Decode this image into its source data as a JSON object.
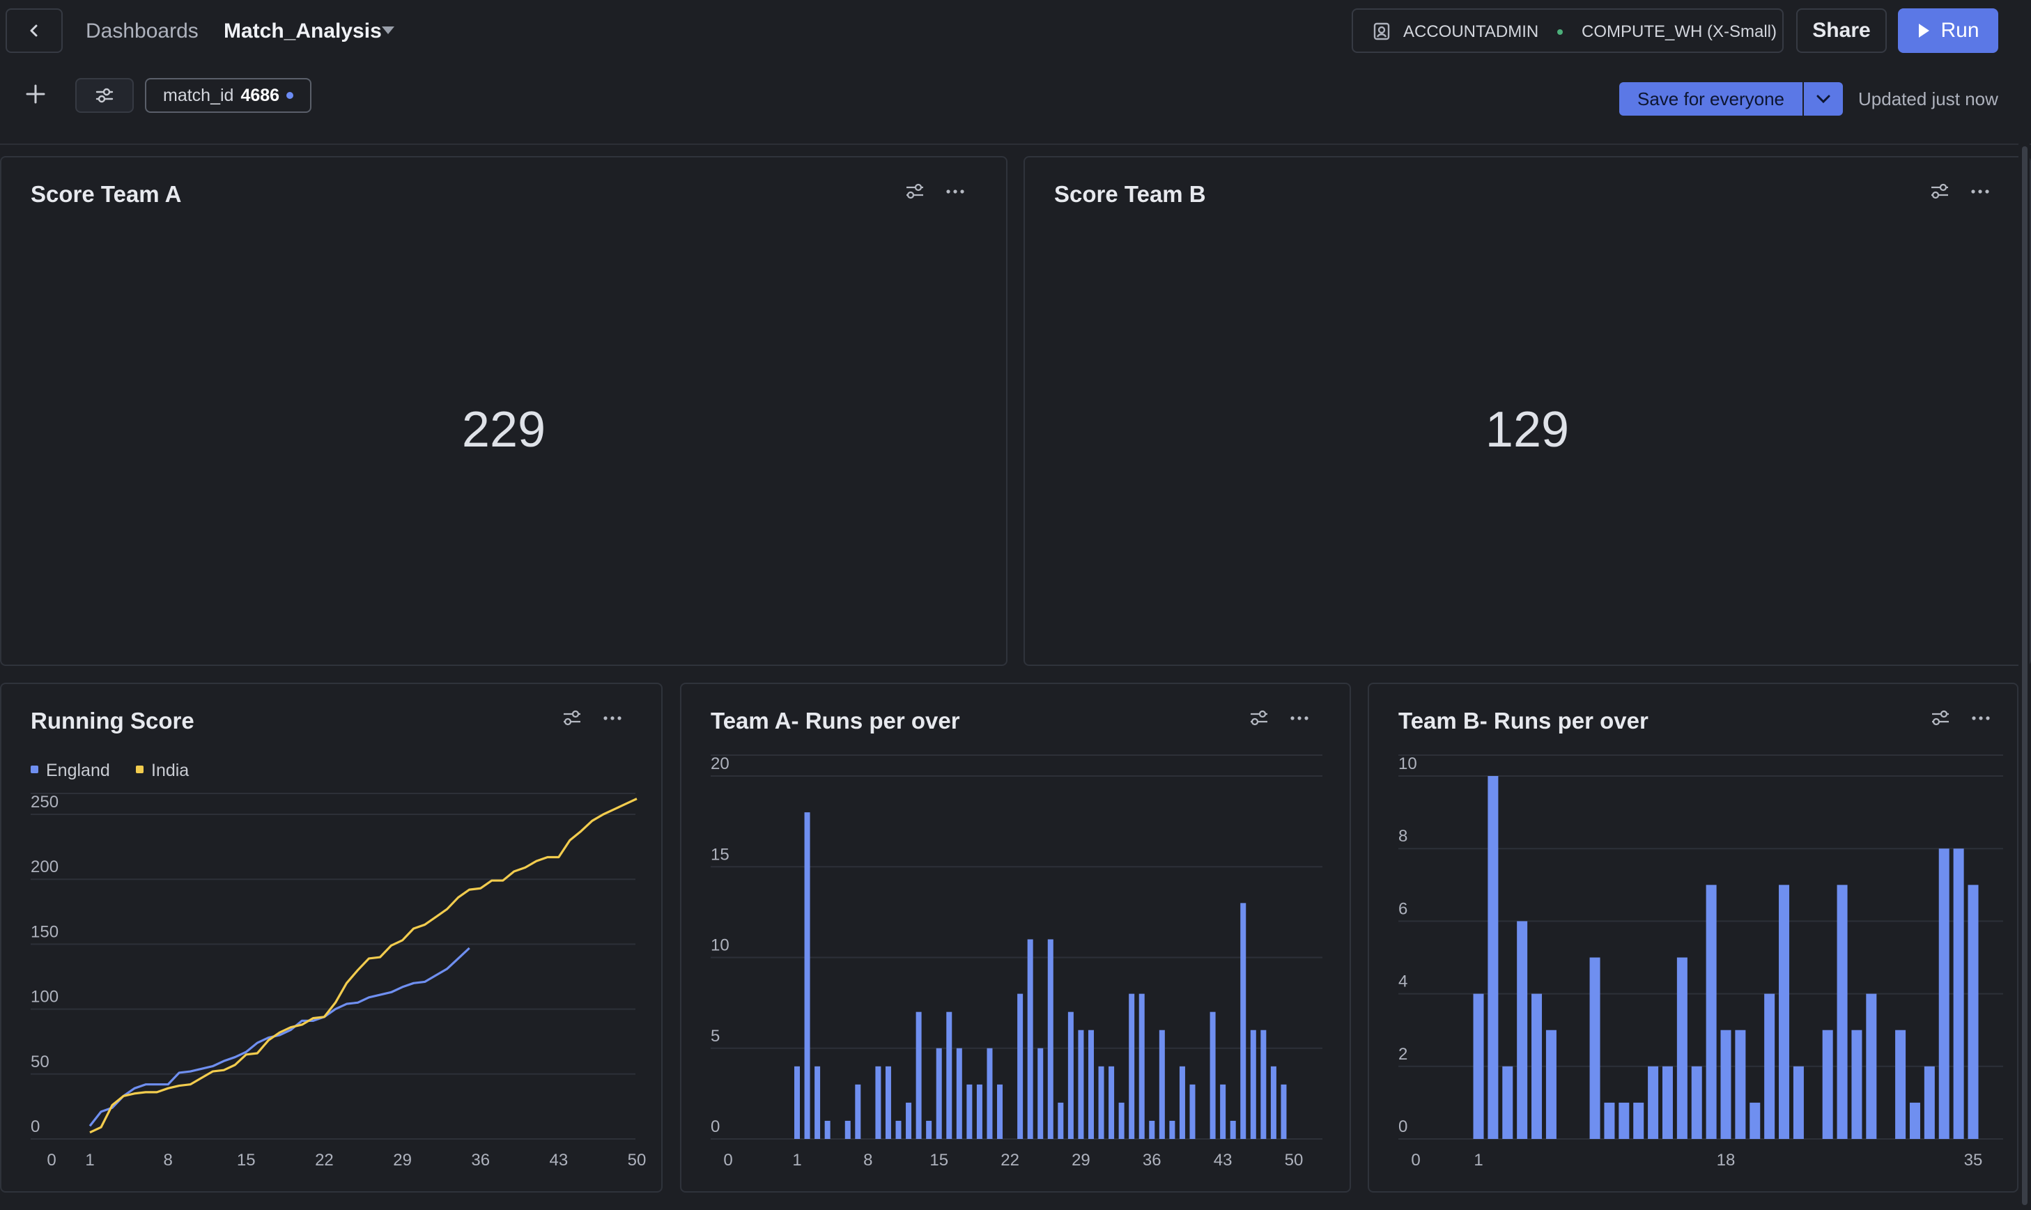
{
  "header": {
    "breadcrumb": "Dashboards",
    "dashboard_title": "Match_Analysis",
    "role": "ACCOUNTADMIN",
    "warehouse": "COMPUTE_WH (X-Small)",
    "share_label": "Share",
    "run_label": "Run"
  },
  "filters": {
    "chip_key": "match_id",
    "chip_value": "4686"
  },
  "actions": {
    "save_label": "Save for everyone",
    "updated_text": "Updated just now"
  },
  "colors": {
    "accent": "#5b78e6",
    "england": "#6f8ff0",
    "india": "#f2cc4e",
    "bar": "#6f8ff0"
  },
  "panels": {
    "score_a": {
      "title": "Score Team A",
      "value": "229"
    },
    "score_b": {
      "title": "Score Team B",
      "value": "129"
    },
    "running": {
      "title": "Running Score"
    },
    "team_a_runs": {
      "title": "Team A- Runs per over"
    },
    "team_b_runs": {
      "title": "Team B- Runs per over"
    }
  },
  "chart_data": [
    {
      "type": "line",
      "title": "Running Score",
      "ylim": [
        0,
        250
      ],
      "yticks": [
        0,
        50,
        100,
        150,
        200,
        250
      ],
      "xticks": [
        1,
        8,
        15,
        22,
        29,
        36,
        43,
        50
      ],
      "legend_position": "top-left",
      "series": [
        {
          "name": "England",
          "color": "#6f8ff0",
          "x": [
            1,
            2,
            3,
            4,
            5,
            6,
            7,
            8,
            9,
            10,
            11,
            12,
            13,
            14,
            15,
            16,
            17,
            18,
            19,
            20,
            21,
            22,
            23,
            24,
            25,
            26,
            27,
            28,
            29,
            30,
            31,
            32,
            33,
            34,
            35
          ],
          "values": [
            10,
            21,
            24,
            33,
            39,
            42,
            42,
            42,
            51,
            52,
            54,
            56,
            60,
            63,
            67,
            74,
            78,
            80,
            84,
            91,
            91,
            94,
            100,
            104,
            105,
            109,
            111,
            113,
            117,
            120,
            121,
            126,
            131,
            139,
            147
          ]
        },
        {
          "name": "India",
          "color": "#f2cc4e",
          "x": [
            1,
            2,
            3,
            4,
            5,
            6,
            7,
            8,
            9,
            10,
            11,
            12,
            13,
            14,
            15,
            16,
            17,
            18,
            19,
            20,
            21,
            22,
            23,
            24,
            25,
            26,
            27,
            28,
            29,
            30,
            31,
            32,
            33,
            34,
            35,
            36,
            37,
            38,
            39,
            40,
            41,
            42,
            43,
            44,
            45,
            46,
            47,
            48,
            49,
            50
          ],
          "values": [
            5,
            9,
            26,
            33,
            35,
            36,
            36,
            39,
            41,
            42,
            47,
            52,
            53,
            57,
            65,
            66,
            76,
            82,
            86,
            88,
            93,
            94,
            105,
            120,
            130,
            139,
            140,
            149,
            153,
            162,
            165,
            171,
            177,
            186,
            192,
            193,
            199,
            199,
            206,
            209,
            214,
            217,
            217,
            230,
            237,
            245,
            250,
            254,
            258,
            262
          ]
        }
      ]
    },
    {
      "type": "bar",
      "title": "Team A- Runs per over",
      "ylim": [
        0,
        20
      ],
      "yticks": [
        0,
        5,
        10,
        15,
        20
      ],
      "xticks": [
        1,
        8,
        15,
        22,
        29,
        36,
        43,
        50
      ],
      "x": [
        1,
        2,
        3,
        4,
        5,
        6,
        7,
        8,
        9,
        10,
        11,
        12,
        13,
        14,
        15,
        16,
        17,
        18,
        19,
        20,
        21,
        22,
        23,
        24,
        25,
        26,
        27,
        28,
        29,
        30,
        31,
        32,
        33,
        34,
        35,
        36,
        37,
        38,
        39,
        40,
        41,
        42,
        43,
        44,
        45,
        46,
        47,
        48,
        49,
        50
      ],
      "values": [
        4,
        18,
        4,
        1,
        0,
        1,
        3,
        0,
        4,
        4,
        1,
        2,
        7,
        1,
        5,
        7,
        5,
        3,
        3,
        5,
        3,
        0,
        8,
        11,
        5,
        11,
        2,
        7,
        6,
        6,
        4,
        4,
        2,
        8,
        8,
        1,
        6,
        1,
        4,
        3,
        0,
        7,
        3,
        1,
        13,
        6,
        6,
        4,
        3,
        0
      ]
    },
    {
      "type": "bar",
      "title": "Team B- Runs per over",
      "ylim": [
        0,
        10
      ],
      "yticks": [
        0,
        2,
        4,
        6,
        8,
        10
      ],
      "xticks": [
        1,
        18,
        35
      ],
      "x": [
        1,
        2,
        3,
        4,
        5,
        6,
        7,
        8,
        9,
        10,
        11,
        12,
        13,
        14,
        15,
        16,
        17,
        18,
        19,
        20,
        21,
        22,
        23,
        24,
        25,
        26,
        27,
        28,
        29,
        30,
        31,
        32,
        33,
        34,
        35
      ],
      "values": [
        4,
        10,
        2,
        6,
        4,
        3,
        0,
        0,
        5,
        1,
        1,
        1,
        2,
        2,
        5,
        2,
        7,
        3,
        3,
        1,
        4,
        7,
        2,
        0,
        3,
        7,
        3,
        4,
        0,
        3,
        1,
        2,
        8,
        8,
        7
      ]
    }
  ]
}
